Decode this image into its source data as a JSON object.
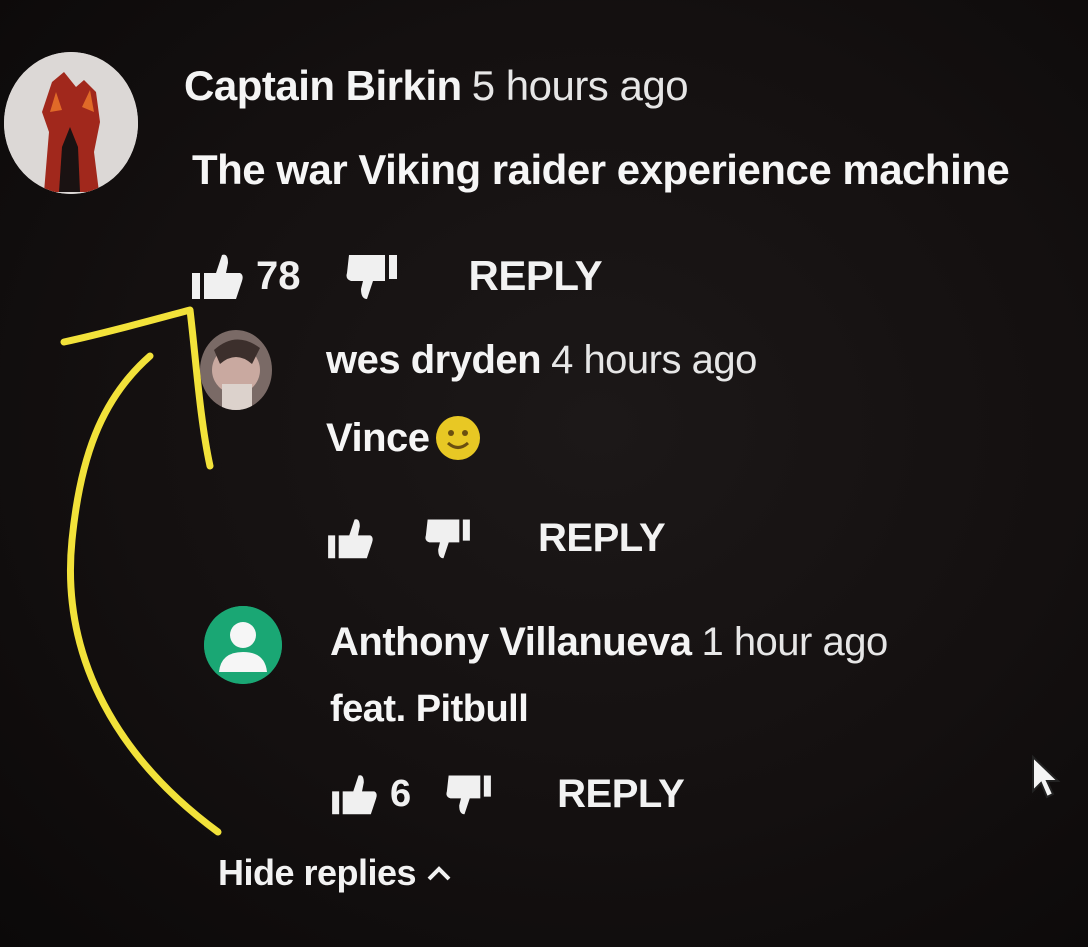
{
  "comments": [
    {
      "author": "Captain Birkin",
      "time": "5 hours ago",
      "text": "The war Viking raider experience machine",
      "likes": "78",
      "reply_label": "REPLY",
      "avatar": "red-figure-avatar"
    }
  ],
  "replies": [
    {
      "author": "wes dryden",
      "time": "4 hours ago",
      "text": "Vince",
      "emoji": "slightly-smiling-face",
      "likes": "",
      "reply_label": "REPLY",
      "avatar": "photo-avatar"
    },
    {
      "author": "Anthony Villanueva",
      "time": "1 hour ago",
      "text": "feat. Pitbull",
      "likes": "6",
      "reply_label": "REPLY",
      "avatar": "default-user-avatar"
    }
  ],
  "hide_replies_label": "Hide replies",
  "colors": {
    "annotation": "#f2e23a",
    "default_avatar": "#1aa774",
    "background": "#120f0f"
  },
  "icons": {
    "like": "thumbs-up-icon",
    "dislike": "thumbs-down-icon",
    "hide": "chevron-up-icon",
    "pointer": "mouse-cursor-icon"
  }
}
